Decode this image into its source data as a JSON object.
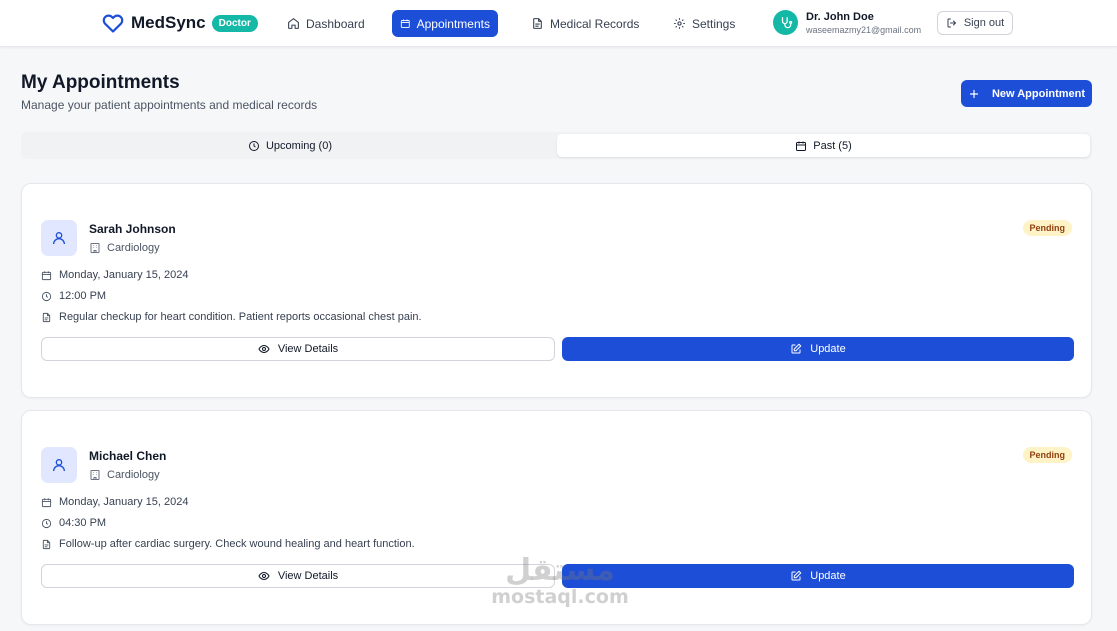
{
  "app": {
    "name": "MedSync",
    "role_badge": "Doctor",
    "accent_color": "#1d4ed8",
    "teal_color": "#14b8a6"
  },
  "nav": {
    "items": [
      {
        "label": "Dashboard",
        "icon": "home-icon",
        "active": false
      },
      {
        "label": "Appointments",
        "icon": "calendar-icon",
        "active": true
      },
      {
        "label": "Medical Records",
        "icon": "file-icon",
        "active": false
      },
      {
        "label": "Settings",
        "icon": "gear-icon",
        "active": false
      }
    ]
  },
  "user": {
    "name": "Dr. John Doe",
    "email": "waseemazmy21@gmail.com",
    "icon": "stethoscope-icon",
    "signout_label": "Sign out"
  },
  "page": {
    "title": "My Appointments",
    "subtitle": "Manage your patient appointments and medical records",
    "new_button": "New Appointment"
  },
  "tabs": {
    "upcoming": "Upcoming (0)",
    "past": "Past (5)",
    "selected": "past"
  },
  "appointments": [
    {
      "patient": "Sarah Johnson",
      "department": "Cardiology",
      "status": "Pending",
      "date": "Monday, January 15, 2024",
      "time": "12:00 PM",
      "note": "Regular checkup for heart condition. Patient reports occasional chest pain.",
      "view_label": "View Details",
      "update_label": "Update"
    },
    {
      "patient": "Michael Chen",
      "department": "Cardiology",
      "status": "Pending",
      "date": "Monday, January 15, 2024",
      "time": "04:30 PM",
      "note": "Follow-up after cardiac surgery. Check wound healing and heart function.",
      "view_label": "View Details",
      "update_label": "Update"
    }
  ],
  "watermark": {
    "arabic": "مستقل",
    "latin": "mostaql.com"
  }
}
